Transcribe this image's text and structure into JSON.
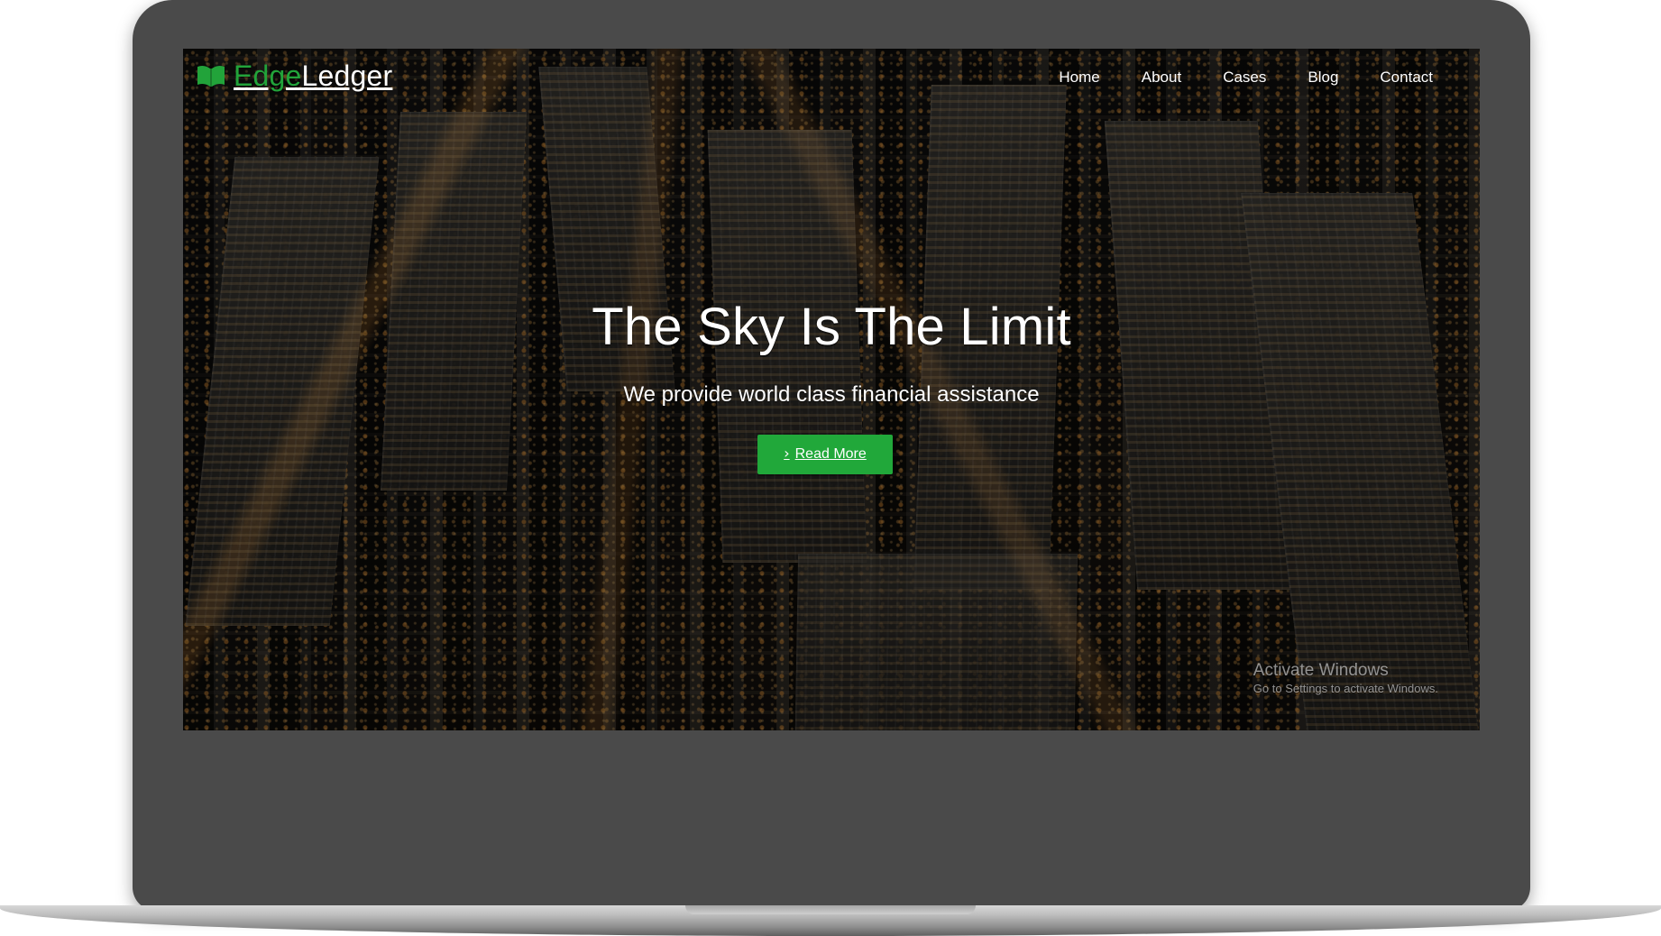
{
  "nav": {
    "brand": {
      "icon": "open-book-icon",
      "part1": "Edge",
      "part2": "Ledger"
    },
    "items": [
      {
        "label": "Home"
      },
      {
        "label": "About"
      },
      {
        "label": "Cases"
      },
      {
        "label": "Blog"
      },
      {
        "label": "Contact"
      }
    ]
  },
  "hero": {
    "title": "The Sky Is The Limit",
    "subtitle": "We provide world class financial assistance",
    "cta": {
      "icon": "chevron-right-icon",
      "label": "Read More"
    }
  },
  "watermark": {
    "title": "Activate Windows",
    "subtitle": "Go to Settings to activate Windows."
  },
  "colors": {
    "brand_green": "#22a33a",
    "button_green": "#21a83a",
    "laptop_gray": "#4a4a4a",
    "text_white": "#ffffff"
  }
}
